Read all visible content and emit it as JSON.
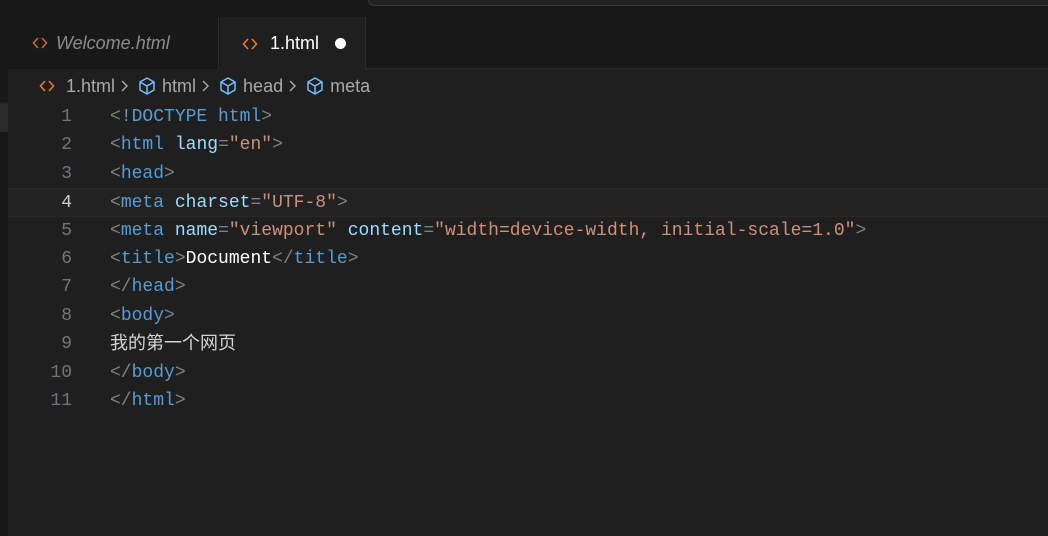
{
  "tabs": [
    {
      "label": "Welcome.html",
      "active": false,
      "icon": "code-brackets-icon"
    },
    {
      "label": "1.html",
      "active": true,
      "modified": true,
      "icon": "code-brackets-icon"
    }
  ],
  "breadcrumb": [
    {
      "label": "1.html",
      "icon": "code-brackets-icon"
    },
    {
      "label": "html",
      "icon": "cube-icon"
    },
    {
      "label": "head",
      "icon": "cube-icon"
    },
    {
      "label": "meta",
      "icon": "cube-icon"
    }
  ],
  "current_line": 4,
  "lines": [
    {
      "n": "1",
      "tokens": [
        [
          "bracket",
          "<"
        ],
        [
          "doctype",
          "!DOCTYPE html"
        ],
        [
          "bracket",
          ">"
        ]
      ]
    },
    {
      "n": "2",
      "tokens": [
        [
          "bracket",
          "<"
        ],
        [
          "tag",
          "html"
        ],
        [
          "txt",
          " "
        ],
        [
          "attr",
          "lang"
        ],
        [
          "bracket",
          "="
        ],
        [
          "str",
          "\"en\""
        ],
        [
          "bracket",
          ">"
        ]
      ]
    },
    {
      "n": "3",
      "tokens": [
        [
          "bracket",
          "<"
        ],
        [
          "tag",
          "head"
        ],
        [
          "bracket",
          ">"
        ]
      ]
    },
    {
      "n": "4",
      "tokens": [
        [
          "bracket",
          "<"
        ],
        [
          "tag",
          "meta"
        ],
        [
          "txt",
          " "
        ],
        [
          "attr",
          "charset"
        ],
        [
          "bracket",
          "="
        ],
        [
          "str",
          "\"UTF-8\""
        ],
        [
          "bracket",
          ">"
        ]
      ]
    },
    {
      "n": "5",
      "tokens": [
        [
          "bracket",
          "<"
        ],
        [
          "tag",
          "meta"
        ],
        [
          "txt",
          " "
        ],
        [
          "attr",
          "name"
        ],
        [
          "bracket",
          "="
        ],
        [
          "str",
          "\"viewport\""
        ],
        [
          "txt",
          " "
        ],
        [
          "attr",
          "content"
        ],
        [
          "bracket",
          "="
        ],
        [
          "str",
          "\"width=device-width, initial-scale=1.0\""
        ],
        [
          "bracket",
          ">"
        ]
      ]
    },
    {
      "n": "6",
      "tokens": [
        [
          "bracket",
          "<"
        ],
        [
          "tag",
          "title"
        ],
        [
          "bracket",
          ">"
        ],
        [
          "txt",
          "Document"
        ],
        [
          "bracket",
          "</"
        ],
        [
          "tag",
          "title"
        ],
        [
          "bracket",
          ">"
        ]
      ]
    },
    {
      "n": "7",
      "tokens": [
        [
          "bracket",
          "</"
        ],
        [
          "tag",
          "head"
        ],
        [
          "bracket",
          ">"
        ]
      ]
    },
    {
      "n": "8",
      "tokens": [
        [
          "bracket",
          "<"
        ],
        [
          "tag",
          "body"
        ],
        [
          "bracket",
          ">"
        ]
      ]
    },
    {
      "n": "9",
      "plain": "我的第一个网页"
    },
    {
      "n": "10",
      "tokens": [
        [
          "bracket",
          "</"
        ],
        [
          "tag",
          "body"
        ],
        [
          "bracket",
          ">"
        ]
      ]
    },
    {
      "n": "11",
      "tokens": [
        [
          "bracket",
          "</"
        ],
        [
          "tag",
          "html"
        ],
        [
          "bracket",
          ">"
        ]
      ]
    }
  ],
  "colors": {
    "tag": "#569cd6",
    "attr": "#9cdcfe",
    "string": "#ce9178",
    "bracket": "#808080",
    "text": "#ffffff",
    "file_icon": "#e37933",
    "cube_icon": "#75beff"
  }
}
